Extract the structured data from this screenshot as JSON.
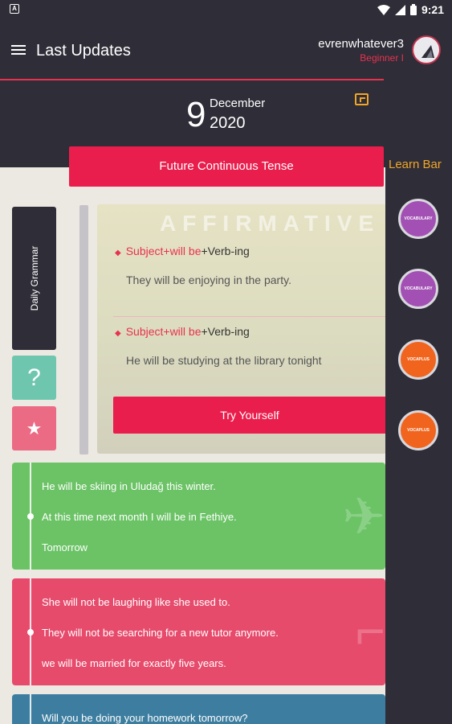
{
  "status": {
    "time": "9:21",
    "battery_icon": "battery-icon",
    "wifi_icon": "wifi-icon",
    "signal_icon": "signal-icon"
  },
  "header": {
    "title": "Last Updates",
    "username": "evrenwhatever3",
    "level": "Beginner I"
  },
  "date": {
    "day": "9",
    "month": "December",
    "year": "2020"
  },
  "topic": "Future Continuous Tense",
  "side": {
    "tab_label": "Daily Grammar",
    "question": "?",
    "star": "★"
  },
  "card": {
    "watermark": "AFFIRMATIVE",
    "rules": [
      {
        "formula_red": "Subject+will be",
        "formula_rest": "+Verb-ing",
        "example": "They will be enjoying in the party."
      },
      {
        "formula_red": "Subject+will be",
        "formula_rest": "+Verb-ing",
        "example": "He will be studying at the library tonight"
      }
    ],
    "try_button": "Try Yourself"
  },
  "examples": {
    "green": [
      "He will be skiing in Uludağ this winter.",
      "At this time next month I will be in Fethiye.",
      "Tomorrow"
    ],
    "pink": [
      "She will not be laughing like she used to.",
      "They will not be searching for a new tutor anymore.",
      "we will be married for exactly five years."
    ],
    "blue": [
      "Will you be doing your homework tomorrow?"
    ]
  },
  "learnbar": {
    "title": "Learn Bar",
    "items": [
      {
        "label": "VOCABULARY"
      },
      {
        "label": "VOCABULARY"
      },
      {
        "label": "VOCAPLUS"
      },
      {
        "label": "VOCAPLUS"
      }
    ]
  },
  "colors": {
    "accent": "#ea1e4c",
    "dark": "#2e2d38",
    "gold": "#f0a628",
    "green": "#6bc366",
    "pink": "#e74b6c",
    "blue": "#3d7ea0"
  }
}
